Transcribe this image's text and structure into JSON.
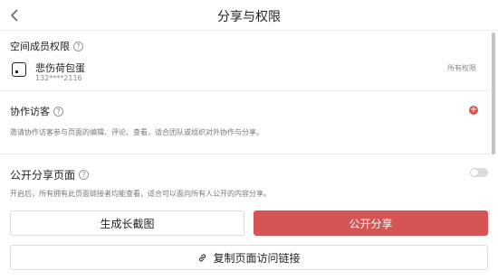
{
  "header": {
    "title": "分享与权限",
    "back_icon": "chevron-left-icon"
  },
  "space_members": {
    "title": "空间成员权限",
    "member": {
      "name": "悲伤荷包蛋",
      "phone": "132****2116",
      "permission": "所有权限"
    }
  },
  "collab_guests": {
    "title": "协作访客",
    "description": "邀请协作访客参与页面的编辑、评论、查看，适合团队或组织对外协作与分享。",
    "add_color": "#d55555"
  },
  "public_share": {
    "title": "公开分享页面",
    "description": "开启后，所有拥有此页面链接者均能查看，适合可以面向所有人公开的内容分享。",
    "enabled": false
  },
  "buttons": {
    "long_image": "生成长截图",
    "public_share": "公开分享",
    "copy_link": "复制页面访问链接"
  },
  "colors": {
    "accent": "#d55555"
  }
}
